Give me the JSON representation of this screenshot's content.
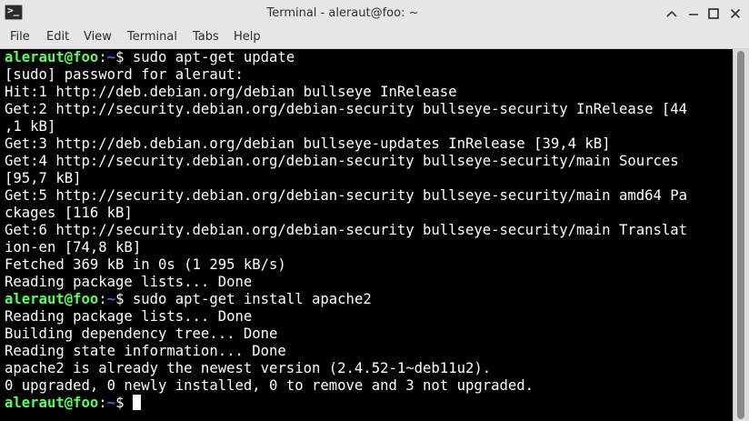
{
  "window": {
    "title": "Terminal - aleraut@foo: ~",
    "icon": "terminal-app-icon",
    "icon_glyph": ">_",
    "controls": [
      "collapse-icon",
      "minimize-icon",
      "maximize-icon",
      "close-icon"
    ]
  },
  "menu": {
    "file": "File",
    "edit": "Edit",
    "view": "View",
    "terminal": "Terminal",
    "tabs": "Tabs",
    "help": "Help"
  },
  "prompt": {
    "user": "aleraut@foo",
    "sep": ":",
    "path": "~",
    "symbol": "$ "
  },
  "terminal": {
    "colors": {
      "background": "#000000",
      "text": "#ffffff",
      "user": "#55ff55",
      "path": "#5c5cff"
    },
    "lines": [
      {
        "type": "prompt",
        "cmd": "sudo apt-get update"
      },
      {
        "type": "out",
        "text": "[sudo] password for aleraut:"
      },
      {
        "type": "out",
        "text": "Hit:1 http://deb.debian.org/debian bullseye InRelease"
      },
      {
        "type": "out",
        "text": "Get:2 http://security.debian.org/debian-security bullseye-security InRelease [44"
      },
      {
        "type": "out",
        "text": ",1 kB]"
      },
      {
        "type": "out",
        "text": "Get:3 http://deb.debian.org/debian bullseye-updates InRelease [39,4 kB]"
      },
      {
        "type": "out",
        "text": "Get:4 http://security.debian.org/debian-security bullseye-security/main Sources"
      },
      {
        "type": "out",
        "text": "[95,7 kB]"
      },
      {
        "type": "out",
        "text": "Get:5 http://security.debian.org/debian-security bullseye-security/main amd64 Pa"
      },
      {
        "type": "out",
        "text": "ckages [116 kB]"
      },
      {
        "type": "out",
        "text": "Get:6 http://security.debian.org/debian-security bullseye-security/main Translat"
      },
      {
        "type": "out",
        "text": "ion-en [74,8 kB]"
      },
      {
        "type": "out",
        "text": "Fetched 369 kB in 0s (1 295 kB/s)"
      },
      {
        "type": "out",
        "text": "Reading package lists... Done"
      },
      {
        "type": "prompt",
        "cmd": "sudo apt-get install apache2"
      },
      {
        "type": "out",
        "text": "Reading package lists... Done"
      },
      {
        "type": "out",
        "text": "Building dependency tree... Done"
      },
      {
        "type": "out",
        "text": "Reading state information... Done"
      },
      {
        "type": "out",
        "text": "apache2 is already the newest version (2.4.52-1~deb11u2)."
      },
      {
        "type": "out",
        "text": "0 upgraded, 0 newly installed, 0 to remove and 3 not upgraded."
      },
      {
        "type": "prompt",
        "cmd": "",
        "cursor": true
      }
    ]
  }
}
